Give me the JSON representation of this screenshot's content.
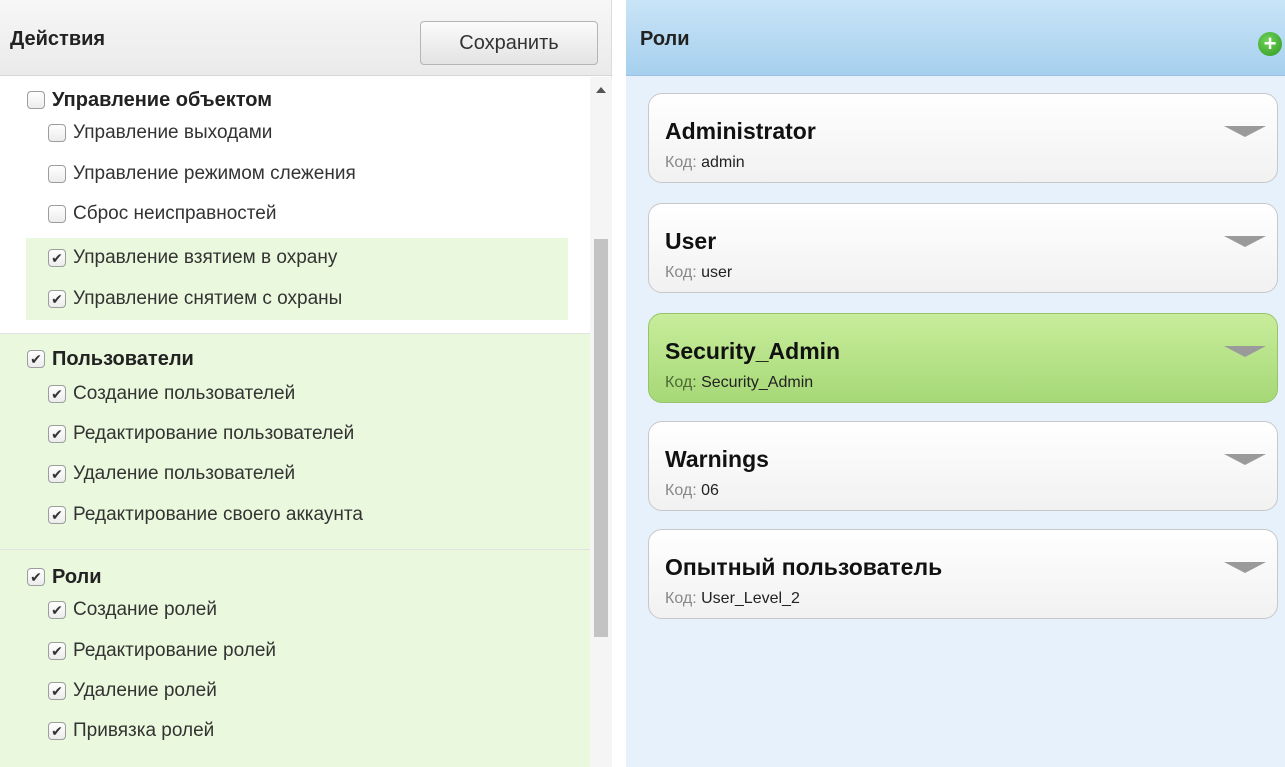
{
  "actions_panel": {
    "title": "Действия",
    "save_label": "Сохранить",
    "groups": [
      {
        "label": "Управление объектом",
        "checked": false,
        "items": [
          {
            "label": "Управление выходами",
            "checked": false
          },
          {
            "label": "Управление режимом слежения",
            "checked": false
          },
          {
            "label": "Сброс неисправностей",
            "checked": false
          },
          {
            "label": "Управление взятием в охрану",
            "checked": true
          },
          {
            "label": "Управление снятием с охраны",
            "checked": true
          }
        ]
      },
      {
        "label": "Пользователи",
        "checked": true,
        "items": [
          {
            "label": "Создание пользователей",
            "checked": true
          },
          {
            "label": "Редактирование пользователей",
            "checked": true
          },
          {
            "label": "Удаление пользователей",
            "checked": true
          },
          {
            "label": "Редактирование своего аккаунта",
            "checked": true
          }
        ]
      },
      {
        "label": "Роли",
        "checked": true,
        "items": [
          {
            "label": "Создание ролей",
            "checked": true
          },
          {
            "label": "Редактирование ролей",
            "checked": true
          },
          {
            "label": "Удаление ролей",
            "checked": true
          },
          {
            "label": "Привязка ролей",
            "checked": true
          }
        ]
      }
    ]
  },
  "roles_panel": {
    "title": "Роли",
    "code_label": "Код:",
    "roles": [
      {
        "name": "Administrator",
        "code": "admin",
        "selected": false
      },
      {
        "name": "User",
        "code": "user",
        "selected": false
      },
      {
        "name": "Security_Admin",
        "code": "Security_Admin",
        "selected": true
      },
      {
        "name": "Warnings",
        "code": "06",
        "selected": false
      },
      {
        "name": "Опытный пользователь",
        "code": "User_Level_2",
        "selected": false
      }
    ]
  },
  "colors": {
    "checked_row_bg": "#eaf8dd",
    "selected_role_bg": "#b6e287",
    "right_header_bg": "#b8daf2",
    "right_panel_bg": "#e6f1fb"
  },
  "icons": {
    "add": "plus-circle-icon",
    "dropdown": "triangle-down-icon",
    "check": "check-icon"
  }
}
